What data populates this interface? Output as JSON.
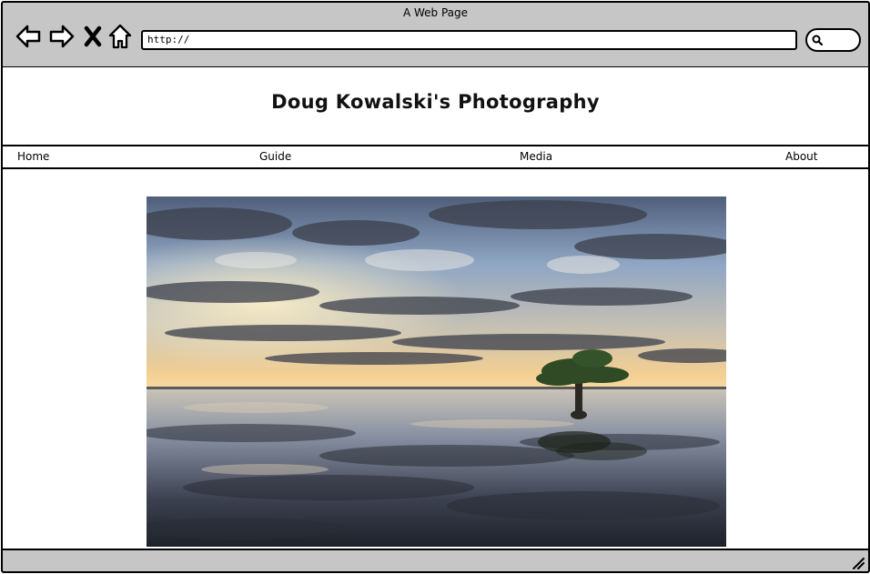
{
  "window": {
    "title": "A Web Page"
  },
  "toolbar": {
    "back_icon": "back-arrow-icon",
    "forward_icon": "forward-arrow-icon",
    "stop_icon": "close-x-icon",
    "home_icon": "home-icon",
    "search_icon": "search-icon"
  },
  "address_bar": {
    "value": "http://"
  },
  "page": {
    "title": "Doug Kowalski's Photography",
    "nav": [
      {
        "label": "Home"
      },
      {
        "label": "Guide"
      },
      {
        "label": "Media"
      },
      {
        "label": "About"
      }
    ],
    "hero_image": {
      "subject": "lone tree standing in calm water at sunrise under dramatic clouds"
    }
  },
  "colors": {
    "chrome_gray": "#c6c6c6",
    "outline": "#000000",
    "page_background": "#ffffff"
  }
}
